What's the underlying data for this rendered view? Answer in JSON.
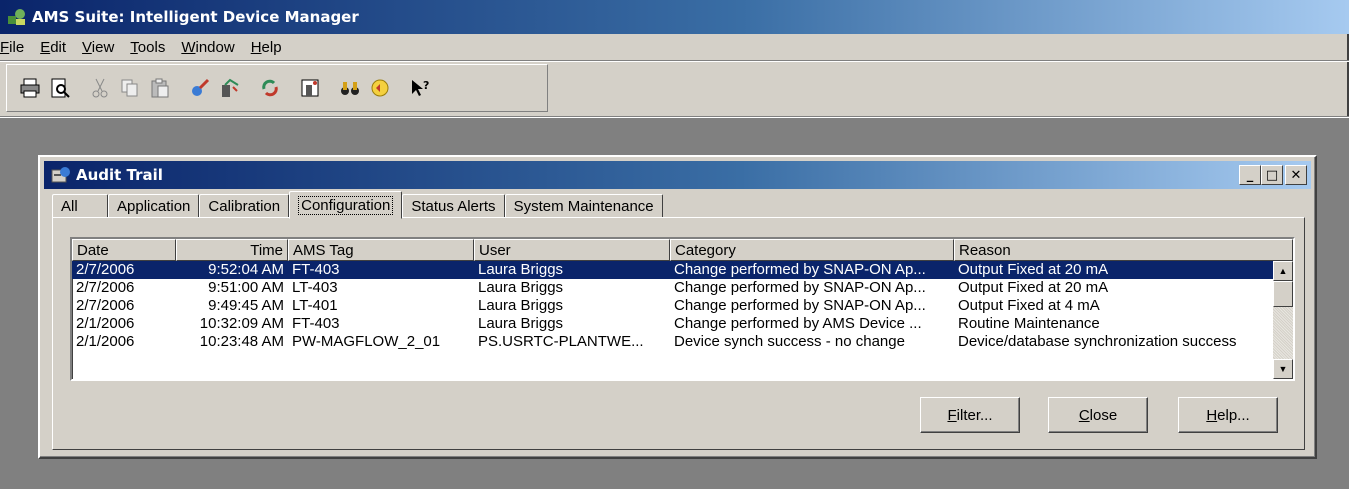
{
  "app": {
    "title": "AMS Suite: Intelligent Device Manager",
    "icon": "ams-app-icon"
  },
  "menu": [
    {
      "key": "F",
      "rest": "ile"
    },
    {
      "key": "E",
      "rest": "dit"
    },
    {
      "key": "V",
      "rest": "iew"
    },
    {
      "key": "T",
      "rest": "ools"
    },
    {
      "key": "W",
      "rest": "indow"
    },
    {
      "key": "H",
      "rest": "elp"
    }
  ],
  "toolbar": [
    "print-icon",
    "print-preview-icon",
    "cut-icon",
    "copy-icon",
    "paste-icon",
    "device-connect-icon",
    "device-explorer-icon",
    "refresh-icon",
    "device-tag-icon",
    "binoculars-icon",
    "alert-monitor-icon",
    "context-help-icon"
  ],
  "dialog": {
    "title": "Audit Trail",
    "icon": "audit-trail-icon",
    "tabs": [
      "All",
      "Application",
      "Calibration",
      "Configuration",
      "Status Alerts",
      "System Maintenance"
    ],
    "active_tab": "Configuration",
    "columns": [
      "Date",
      "Time",
      "AMS Tag",
      "User",
      "Category",
      "Reason"
    ],
    "rows": [
      [
        "2/7/2006",
        "9:52:04 AM",
        "FT-403",
        "Laura Briggs",
        "Change performed by SNAP-ON Ap...",
        "Output Fixed at 20 mA"
      ],
      [
        "2/7/2006",
        "9:51:00 AM",
        "LT-403",
        "Laura Briggs",
        "Change performed by SNAP-ON Ap...",
        "Output Fixed at 20 mA"
      ],
      [
        "2/7/2006",
        "9:49:45 AM",
        "LT-401",
        "Laura Briggs",
        "Change performed by SNAP-ON Ap...",
        "Output Fixed at 4 mA"
      ],
      [
        "2/1/2006",
        "10:32:09 AM",
        "FT-403",
        "Laura Briggs",
        "Change performed by AMS Device ...",
        "Routine Maintenance"
      ],
      [
        "2/1/2006",
        "10:23:48 AM",
        "PW-MAGFLOW_2_01",
        "PS.USRTC-PLANTWE...",
        "Device synch success - no change",
        "Device/database synchronization success"
      ]
    ],
    "selected_row": 0,
    "buttons": {
      "filter": {
        "key": "F",
        "rest": "ilter..."
      },
      "close": {
        "key": "C",
        "rest": "lose"
      },
      "help": {
        "key": "H",
        "rest": "elp..."
      }
    }
  }
}
